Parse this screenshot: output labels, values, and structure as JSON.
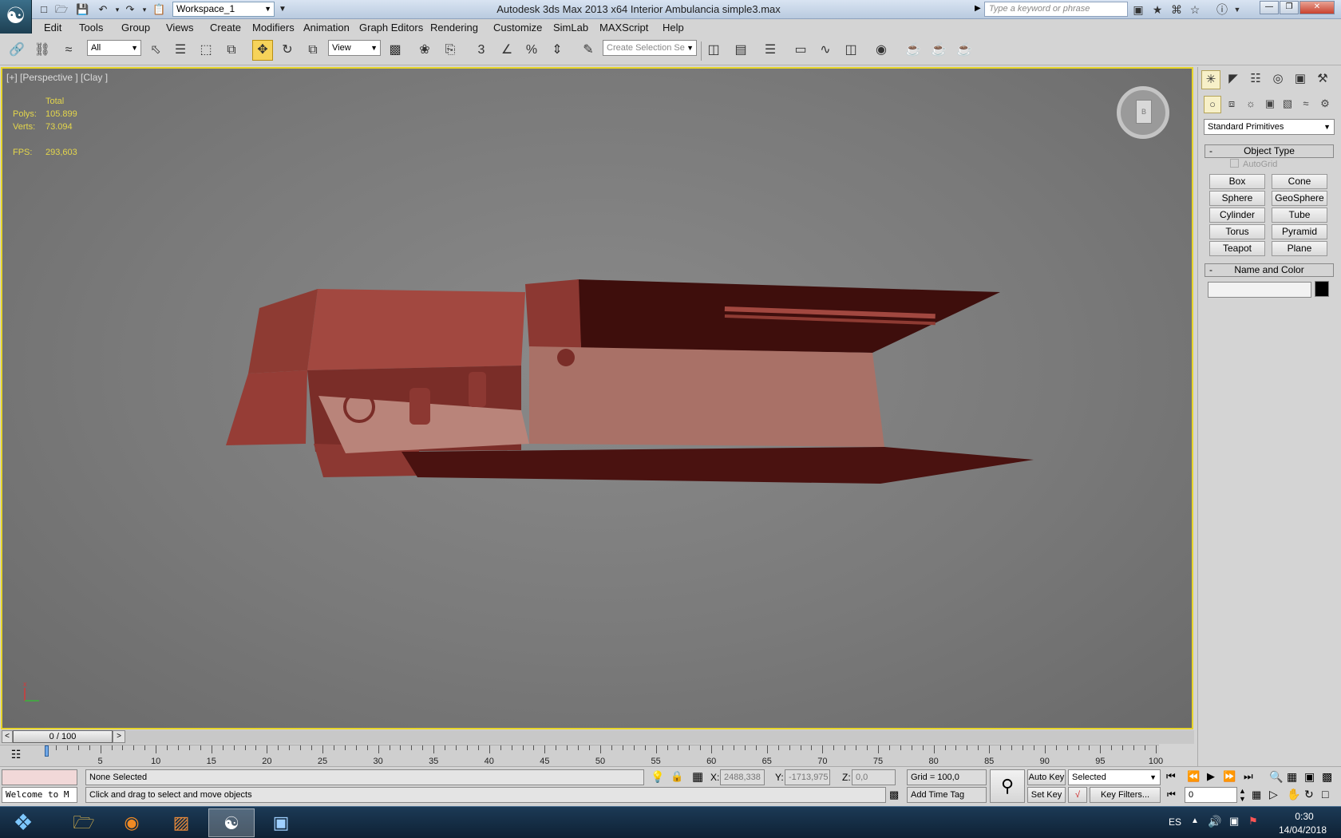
{
  "titlebar": {
    "workspace": "Workspace_1",
    "title": "Autodesk 3ds Max  2013 x64      Interior Ambulancia simple3.max",
    "search_placeholder": "Type a keyword or phrase"
  },
  "menu": [
    "Edit",
    "Tools",
    "Group",
    "Views",
    "Create",
    "Modifiers",
    "Animation",
    "Graph Editors",
    "Rendering",
    "Customize",
    "SimLab",
    "MAXScript",
    "Help"
  ],
  "toolbar": {
    "selection_filter": "All",
    "reference_coord": "View",
    "snap_label": "3",
    "named_selection_placeholder": "Create Selection Se"
  },
  "viewport": {
    "label": "[+] [Perspective ] [Clay ]",
    "stats": {
      "total_label": "Total",
      "polys_label": "Polys:",
      "polys": "105.899",
      "verts_label": "Verts:",
      "verts": "73.094",
      "fps_label": "FPS:",
      "fps": "293,603"
    },
    "viewcube_face": "B",
    "axis_x": "x",
    "model_color": "#8a3a33"
  },
  "timeslider": {
    "prev": "<",
    "position": "0 / 100",
    "next": ">"
  },
  "trackbar": {
    "ticks": [
      "5",
      "10",
      "15",
      "20",
      "25",
      "30",
      "35",
      "40",
      "45",
      "50",
      "55",
      "60",
      "65",
      "70",
      "75",
      "80",
      "85",
      "90",
      "95",
      "100"
    ]
  },
  "status": {
    "maxscript_listener": "Welcome to M",
    "selection": "None Selected",
    "prompt": "Click and drag to select and move objects",
    "x_label": "X:",
    "x": "2488,338",
    "y_label": "Y:",
    "y": "-1713,975",
    "z_label": "Z:",
    "z": "0,0",
    "grid": "Grid = 100,0",
    "add_time_tag": "Add Time Tag",
    "auto_key": "Auto Key",
    "key_mode": "Selected",
    "set_key": "Set Key",
    "key_filters": "Key Filters...",
    "frame": "0"
  },
  "command_panel": {
    "category": "Standard Primitives",
    "object_type": "Object Type",
    "autogrid": "AutoGrid",
    "buttons": [
      "Box",
      "Cone",
      "Sphere",
      "GeoSphere",
      "Cylinder",
      "Tube",
      "Torus",
      "Pyramid",
      "Teapot",
      "Plane"
    ],
    "name_and_color": "Name and Color",
    "object_color": "#000000"
  },
  "taskbar": {
    "lang": "ES",
    "time": "0:30",
    "date": "14/04/2018"
  }
}
